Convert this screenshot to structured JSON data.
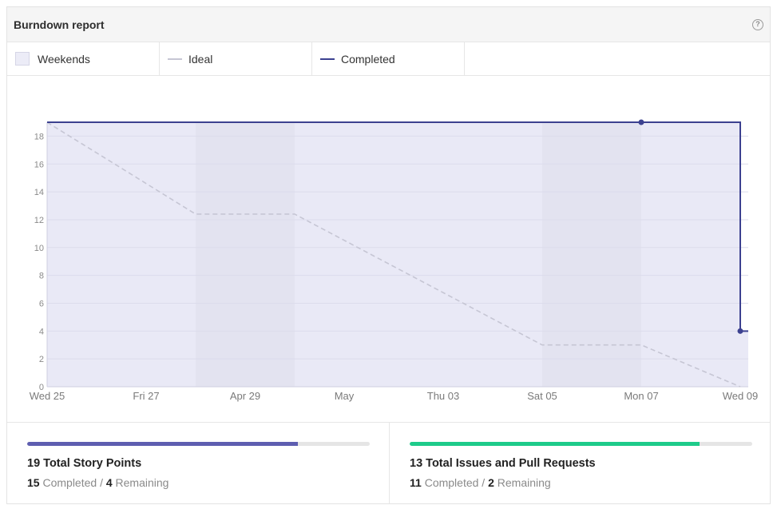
{
  "header": {
    "title": "Burndown report",
    "help_glyph": "?"
  },
  "legend": {
    "weekends": "Weekends",
    "ideal": "Ideal",
    "completed": "Completed"
  },
  "colors": {
    "completed": "#3c4190",
    "ideal": "#c6c6d4",
    "area": "#e9e9f6",
    "weekend": "#e2e2ef",
    "story_bar": "#5e5eb0",
    "issues_bar": "#1ecb8a",
    "grid": "#dcdcec"
  },
  "chart_data": {
    "type": "line",
    "title": "",
    "xlabel": "",
    "ylabel": "",
    "ylim": [
      0,
      19
    ],
    "yticks": [
      0,
      2,
      4,
      6,
      8,
      10,
      12,
      14,
      16,
      18
    ],
    "x_range": [
      "2026-04-25",
      "2026-05-09"
    ],
    "xtick_labels": [
      {
        "date": "2026-04-25",
        "label": "Wed 25"
      },
      {
        "date": "2026-04-27",
        "label": "Fri 27"
      },
      {
        "date": "2026-04-29",
        "label": "Apr 29"
      },
      {
        "date": "2026-05-01",
        "label": "May"
      },
      {
        "date": "2026-05-03",
        "label": "Thu 03"
      },
      {
        "date": "2026-05-05",
        "label": "Sat 05"
      },
      {
        "date": "2026-05-07",
        "label": "Mon 07"
      },
      {
        "date": "2026-05-09",
        "label": "Wed 09"
      }
    ],
    "weekends": [
      {
        "start": "2026-04-28",
        "end": "2026-04-30"
      },
      {
        "start": "2026-05-05",
        "end": "2026-05-07"
      }
    ],
    "series": [
      {
        "name": "Ideal",
        "style": "dashed",
        "points": [
          {
            "x": "2026-04-25",
            "y": 19
          },
          {
            "x": "2026-04-28",
            "y": 12.4
          },
          {
            "x": "2026-04-30",
            "y": 12.4
          },
          {
            "x": "2026-05-05",
            "y": 3
          },
          {
            "x": "2026-05-07",
            "y": 3
          },
          {
            "x": "2026-05-09",
            "y": 0
          }
        ]
      },
      {
        "name": "Completed",
        "style": "step",
        "points": [
          {
            "x": "2026-04-25",
            "y": 19
          },
          {
            "x": "2026-05-07",
            "y": 19
          },
          {
            "x": "2026-05-09",
            "y": 4
          }
        ],
        "markers": [
          {
            "x": "2026-05-07",
            "y": 19
          },
          {
            "x": "2026-05-09",
            "y": 4
          }
        ]
      }
    ]
  },
  "stats": {
    "story_points": {
      "title": "19 Total Story Points",
      "completed_value": "15",
      "completed_label": "Completed",
      "separator": "/",
      "remaining_value": "4",
      "remaining_label": "Remaining",
      "progress": 0.79
    },
    "issues": {
      "title": "13 Total Issues and Pull Requests",
      "completed_value": "11",
      "completed_label": "Completed",
      "separator": "/",
      "remaining_value": "2",
      "remaining_label": "Remaining",
      "progress": 0.846
    }
  }
}
